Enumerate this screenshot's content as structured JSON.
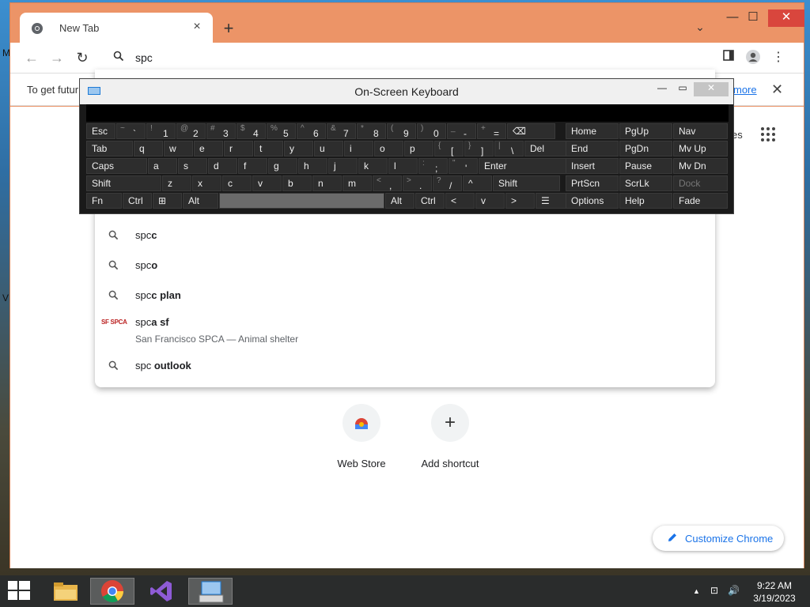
{
  "desktop": {
    "fragments": [
      "M",
      "V"
    ]
  },
  "window": {
    "tab_title": "New Tab",
    "tab_close": "×",
    "new_tab": "+",
    "tab_search": "⌄",
    "minimize": "—",
    "maximize": "☐",
    "close": "✕"
  },
  "toolbar": {
    "back": "←",
    "forward": "→",
    "reload": "↻",
    "omnibox_value": "spc",
    "omnibox_placeholder": "",
    "menu": "⋮"
  },
  "infobar": {
    "text": "To get futur",
    "link": "more",
    "close": "✕"
  },
  "content": {
    "apps_label": "es",
    "tiles": [
      {
        "label": "Web Store",
        "icon": "web-store-icon"
      },
      {
        "label": "Add shortcut",
        "icon": "plus-icon"
      }
    ],
    "customize_label": "Customize Chrome"
  },
  "suggestions": [
    {
      "prefix": "spc",
      "bold": "c",
      "sub": ""
    },
    {
      "prefix": "spc",
      "bold": "o",
      "sub": ""
    },
    {
      "prefix": "spc",
      "bold": "c plan",
      "sub": ""
    },
    {
      "prefix": "spc",
      "bold": "a sf",
      "sub": "San Francisco SPCA — Animal shelter",
      "logo": "SF SPCA"
    },
    {
      "prefix": "spc ",
      "bold": "outlook",
      "sub": ""
    }
  ],
  "osk": {
    "title": "On-Screen Keyboard",
    "minimize": "—",
    "restore": "▭",
    "close": "✕",
    "rows": [
      [
        {
          "m": "Esc"
        },
        {
          "s": "~",
          "m": "`"
        },
        {
          "s": "!",
          "m": "1"
        },
        {
          "s": "@",
          "m": "2"
        },
        {
          "s": "#",
          "m": "3"
        },
        {
          "s": "$",
          "m": "4"
        },
        {
          "s": "%",
          "m": "5"
        },
        {
          "s": "^",
          "m": "6"
        },
        {
          "s": "&",
          "m": "7"
        },
        {
          "s": "*",
          "m": "8"
        },
        {
          "s": "(",
          "m": "9"
        },
        {
          "s": ")",
          "m": "0"
        },
        {
          "s": "_",
          "m": "-"
        },
        {
          "s": "+",
          "m": "="
        },
        {
          "m": "⌫"
        }
      ],
      [
        {
          "m": "Tab"
        },
        {
          "m": "q"
        },
        {
          "m": "w"
        },
        {
          "m": "e"
        },
        {
          "m": "r"
        },
        {
          "m": "t"
        },
        {
          "m": "y"
        },
        {
          "m": "u"
        },
        {
          "m": "i"
        },
        {
          "m": "o"
        },
        {
          "m": "p"
        },
        {
          "s": "{",
          "m": "["
        },
        {
          "s": "}",
          "m": "]"
        },
        {
          "s": "|",
          "m": "\\"
        },
        {
          "m": "Del"
        }
      ],
      [
        {
          "m": "Caps"
        },
        {
          "m": "a"
        },
        {
          "m": "s"
        },
        {
          "m": "d"
        },
        {
          "m": "f"
        },
        {
          "m": "g"
        },
        {
          "m": "h"
        },
        {
          "m": "j"
        },
        {
          "m": "k"
        },
        {
          "m": "l"
        },
        {
          "s": ":",
          "m": ";"
        },
        {
          "s": "\"",
          "m": "'"
        },
        {
          "m": "Enter"
        }
      ],
      [
        {
          "m": "Shift"
        },
        {
          "m": "z"
        },
        {
          "m": "x"
        },
        {
          "m": "c"
        },
        {
          "m": "v"
        },
        {
          "m": "b"
        },
        {
          "m": "n"
        },
        {
          "m": "m"
        },
        {
          "s": "<",
          "m": ","
        },
        {
          "s": ">",
          "m": "."
        },
        {
          "s": "?",
          "m": "/"
        },
        {
          "m": "^"
        },
        {
          "m": "Shift"
        }
      ],
      [
        {
          "m": "Fn"
        },
        {
          "m": "Ctrl"
        },
        {
          "m": "⊞"
        },
        {
          "m": "Alt"
        },
        {
          "m": ""
        },
        {
          "m": "Alt"
        },
        {
          "m": "Ctrl"
        },
        {
          "m": "<"
        },
        {
          "m": "v"
        },
        {
          "m": ">"
        },
        {
          "m": "☰"
        }
      ]
    ],
    "nav": [
      [
        "Home",
        "PgUp",
        "Nav"
      ],
      [
        "End",
        "PgDn",
        "Mv Up"
      ],
      [
        "Insert",
        "Pause",
        "Mv Dn"
      ],
      [
        "PrtScn",
        "ScrLk",
        "Dock"
      ],
      [
        "Options",
        "Help",
        "Fade"
      ]
    ]
  },
  "taskbar": {
    "time": "9:22 AM",
    "date": "3/19/2023",
    "tray": [
      "▲",
      "⊡",
      "🔊"
    ],
    "apps": [
      "start-button",
      "file-explorer-icon",
      "chrome-icon",
      "visual-studio-icon",
      "osk-icon"
    ]
  }
}
